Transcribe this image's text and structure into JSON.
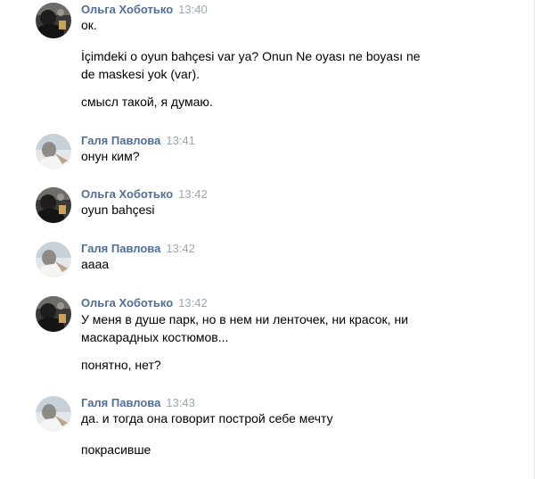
{
  "messages": [
    {
      "author": "Ольга Хоботько",
      "time": "13:40",
      "avatar": "dark-portrait-avatar",
      "lines": [
        "ок.",
        "İçimdeki o oyun bahçesi var ya? Onun Ne oyası ne boyası ne",
        "de maskesi yok (var).",
        "смысл такой, я думаю."
      ]
    },
    {
      "author": "Галя Павлова",
      "time": "13:41",
      "avatar": "light-portrait-avatar",
      "lines": [
        "онун ким?"
      ]
    },
    {
      "author": "Ольга Хоботько",
      "time": "13:42",
      "avatar": "dark-portrait-avatar",
      "lines": [
        "oyun bahçesi"
      ]
    },
    {
      "author": "Галя Павлова",
      "time": "13:42",
      "avatar": "light-portrait-avatar",
      "lines": [
        "аааа"
      ]
    },
    {
      "author": "Ольга Хоботько",
      "time": "13:42",
      "avatar": "dark-portrait-avatar",
      "lines": [
        "У меня в душе парк, но в нем ни ленточек, ни красок, ни",
        "маскарадных костюмов...",
        "понятно, нет?"
      ]
    },
    {
      "author": "Галя Павлова",
      "time": "13:43",
      "avatar": "light-portrait-avatar",
      "lines": [
        "да. и тогда она говорит построй себе мечту",
        "покрасивше"
      ]
    }
  ],
  "colors": {
    "author": "#4f6f97",
    "time": "#9aa5b3",
    "text": "#000000",
    "background": "#ffffff"
  }
}
